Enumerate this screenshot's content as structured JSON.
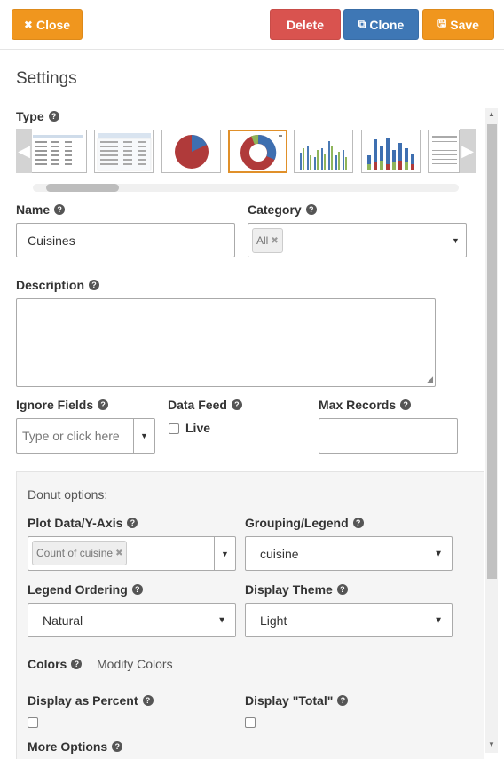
{
  "toolbar": {
    "close_label": "Close",
    "delete_label": "Delete",
    "clone_label": "Clone",
    "save_label": "Save"
  },
  "settings": {
    "heading": "Settings",
    "type_label": "Type",
    "name_label": "Name",
    "name_value": "Cuisines",
    "category_label": "Category",
    "category_tag": "All",
    "description_label": "Description",
    "description_value": "",
    "ignore_fields_label": "Ignore Fields",
    "ignore_fields_placeholder": "Type or click here",
    "data_feed_label": "Data Feed",
    "live_label": "Live",
    "max_records_label": "Max Records",
    "max_records_value": ""
  },
  "chart_types": [
    "table-1",
    "table-2",
    "pie",
    "donut",
    "bar",
    "stacked-bar",
    "list"
  ],
  "selected_type_index": 3,
  "donut": {
    "title": "Donut options:",
    "plot_data_label": "Plot Data/Y-Axis",
    "plot_data_tag": "Count of cuisine",
    "grouping_label": "Grouping/Legend",
    "grouping_value": "cuisine",
    "legend_ordering_label": "Legend Ordering",
    "legend_ordering_value": "Natural",
    "display_theme_label": "Display Theme",
    "display_theme_value": "Light",
    "colors_label": "Colors",
    "modify_colors": "Modify Colors",
    "display_percent_label": "Display as Percent",
    "display_total_label": "Display \"Total\"",
    "more_options_label": "More Options"
  },
  "colors": {
    "orange": "#f0961e",
    "red": "#d9534f",
    "blue": "#3e77b5",
    "selected_border": "#e0902a"
  }
}
